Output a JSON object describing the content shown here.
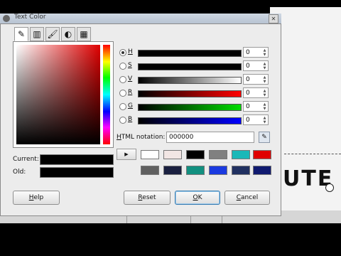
{
  "window": {
    "title": "Text Color"
  },
  "background": {
    "canvas_text": "UTE"
  },
  "selector_tabs": [
    {
      "name": "gimp-selector",
      "glyph": "✎"
    },
    {
      "name": "cmyk-selector",
      "glyph": "▥"
    },
    {
      "name": "watercolor-selector",
      "glyph": "🖌"
    },
    {
      "name": "wheel-selector",
      "glyph": "◐"
    },
    {
      "name": "palette-selector",
      "glyph": "▦"
    }
  ],
  "current_label": "Current:",
  "old_label": "Old:",
  "channels": [
    {
      "key": "H",
      "rest": "",
      "value": "0",
      "selected": true
    },
    {
      "key": "S",
      "rest": "",
      "value": "0",
      "selected": false
    },
    {
      "key": "V",
      "rest": "",
      "value": "0",
      "selected": false
    },
    {
      "key": "R",
      "rest": "",
      "value": "0",
      "selected": false
    },
    {
      "key": "G",
      "rest": "",
      "value": "0",
      "selected": false
    },
    {
      "key": "B",
      "rest": "",
      "value": "0",
      "selected": false
    }
  ],
  "html_notation": {
    "label_underlined": "H",
    "label_rest": "TML notation:",
    "value": "000000"
  },
  "history_colors": [
    "#ffffff",
    "#f2e6e4",
    "#000000",
    "#808080",
    "#1ab8b8",
    "#e00000",
    "#606060",
    "#1a2040",
    "#129080",
    "#1a3ae0",
    "#203060",
    "#101a70"
  ],
  "buttons": {
    "help": {
      "u": "H",
      "rest": "elp"
    },
    "reset": {
      "u": "R",
      "rest": "eset"
    },
    "ok": {
      "u": "O",
      "rest": "K"
    },
    "cancel": {
      "u": "C",
      "rest": "ancel"
    }
  },
  "colors": {
    "current": "#000000",
    "old": "#000000"
  }
}
